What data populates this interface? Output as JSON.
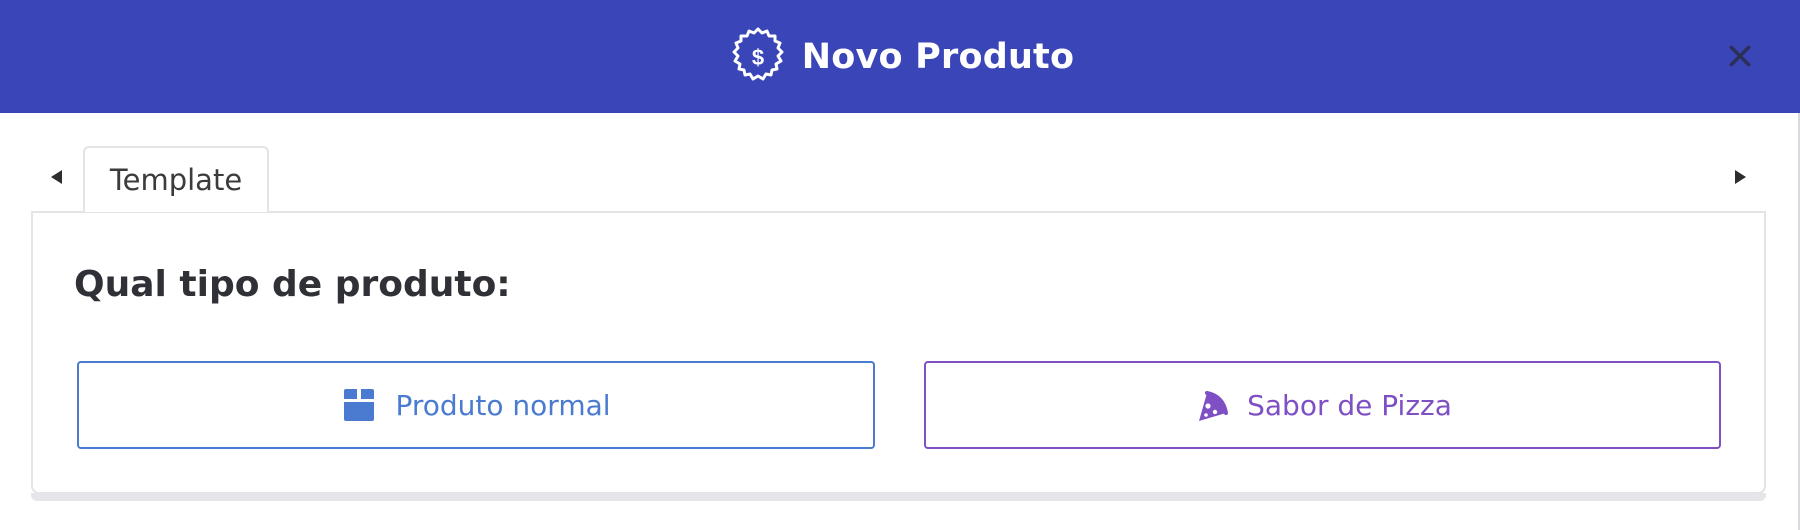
{
  "header": {
    "title": "Novo Produto",
    "icon": "dollar-badge-icon",
    "background_color": "#3a45b8"
  },
  "close": {
    "icon": "close-icon"
  },
  "tabs": {
    "items": [
      {
        "label": "Template",
        "active": true
      }
    ],
    "nav_left_icon": "caret-left-icon",
    "nav_right_icon": "caret-right-icon"
  },
  "content": {
    "question": "Qual tipo de produto:",
    "options": [
      {
        "label": "Produto normal",
        "icon": "box-icon",
        "color": "#4a7bd0"
      },
      {
        "label": "Sabor de Pizza",
        "icon": "pizza-slice-icon",
        "color": "#7f4fc4"
      }
    ]
  }
}
